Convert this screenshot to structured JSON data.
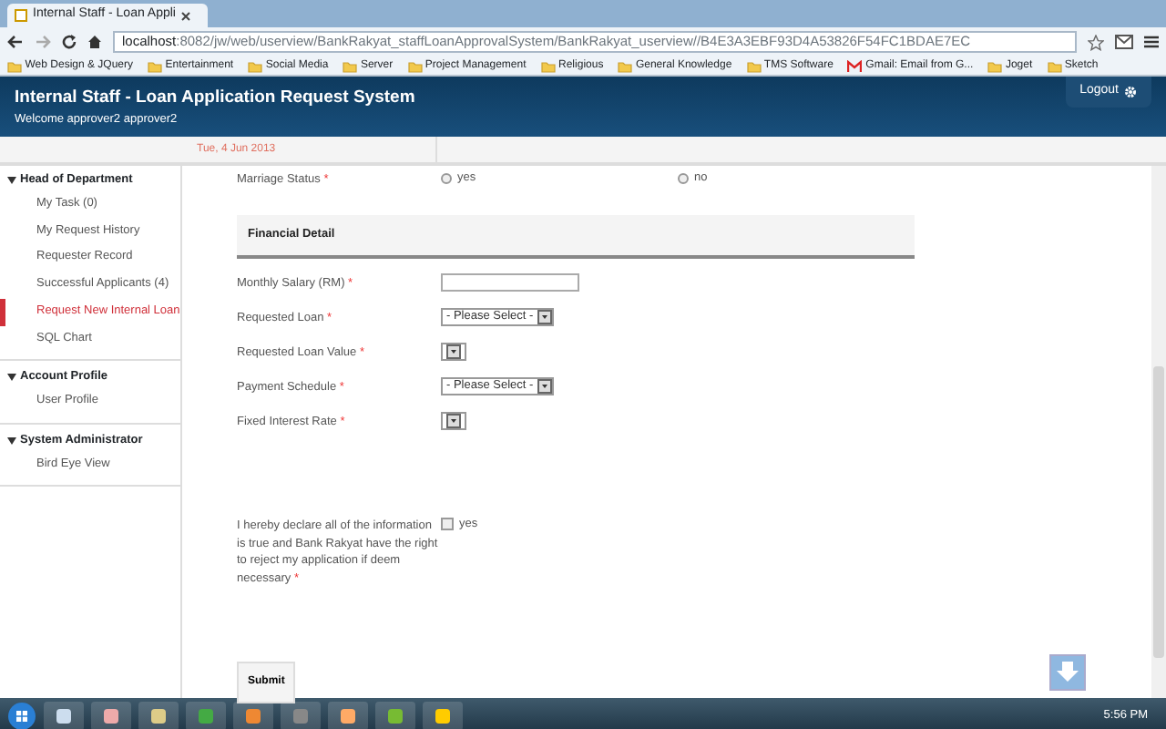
{
  "browser": {
    "tab_title": "Internal Staff - Loan Appli",
    "url_host": "localhost",
    "url_rest": ":8082/jw/web/userview/BankRakyat_staffLoanApprovalSystem/BankRakyat_userview//B4E3A3EBF93D4A53826F54FC1BDAE7EC",
    "bookmarks": [
      {
        "label": "Web Design & JQuery",
        "kind": "folder"
      },
      {
        "label": "Entertainment",
        "kind": "folder"
      },
      {
        "label": "Social Media",
        "kind": "folder"
      },
      {
        "label": "Server",
        "kind": "folder"
      },
      {
        "label": "Project Management",
        "kind": "folder"
      },
      {
        "label": "Religious",
        "kind": "folder"
      },
      {
        "label": "General Knowledge",
        "kind": "folder"
      },
      {
        "label": "TMS Software",
        "kind": "folder"
      },
      {
        "label": "Gmail: Email from G...",
        "kind": "mail"
      },
      {
        "label": "Joget",
        "kind": "folder"
      },
      {
        "label": "Sketch",
        "kind": "folder"
      }
    ]
  },
  "header": {
    "title": "Internal Staff - Loan Application Request System",
    "welcome": "Welcome approver2 approver2",
    "logout": "Logout"
  },
  "date": "Tue, 4 Jun 2013",
  "sidebar": [
    {
      "title": "Head of Department",
      "items": [
        {
          "label": "My Task (0)",
          "selected": false
        },
        {
          "label": "My Request History",
          "selected": false
        },
        {
          "label": "Requester Record",
          "selected": false
        },
        {
          "label": "Successful Applicants (4)",
          "selected": false
        },
        {
          "label": "Request New Internal Loan",
          "selected": true
        },
        {
          "label": "SQL Chart",
          "selected": false
        }
      ]
    },
    {
      "title": "Account Profile",
      "items": [
        {
          "label": "User Profile",
          "selected": false
        }
      ]
    },
    {
      "title": "System Administrator",
      "items": [
        {
          "label": "Bird Eye View",
          "selected": false
        }
      ]
    }
  ],
  "form": [
    {
      "kind": "radio",
      "label": "Marriage Status",
      "required_mark": "*",
      "options": [
        {
          "label": "yes",
          "checked": false
        },
        {
          "label": "no",
          "checked": false
        }
      ]
    },
    {
      "kind": "section",
      "label": "Financial Detail"
    },
    {
      "kind": "text",
      "label": "Monthly Salary (RM)",
      "required_mark": "*"
    },
    {
      "kind": "select",
      "label": "Requested Loan",
      "required_mark": "*",
      "value": "- Please Select -"
    },
    {
      "kind": "select",
      "label": "Requested Loan Value",
      "required_mark": "*"
    },
    {
      "kind": "select",
      "label": "Payment Schedule",
      "required_mark": "*",
      "value": "- Please Select -"
    },
    {
      "kind": "select",
      "label": "Fixed Interest Rate",
      "required_mark": "*"
    },
    {
      "kind": "checkbox",
      "label": "I hereby declare all of the information is true and Bank Rakyat have the right to reject my application if deem necessary",
      "required_mark": "*",
      "options": [
        {
          "label": "yes",
          "checked": false
        }
      ]
    }
  ],
  "submit": "Submit",
  "clock": "5:56 PM"
}
